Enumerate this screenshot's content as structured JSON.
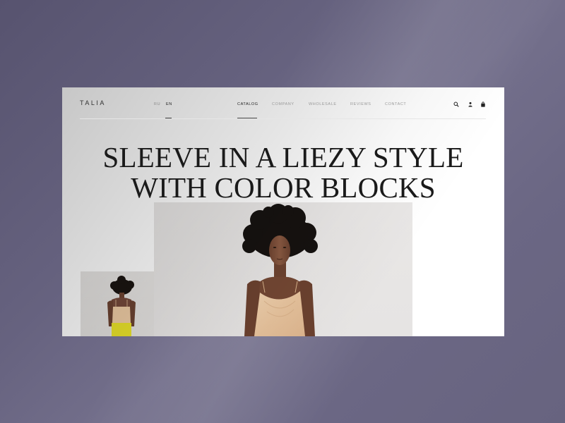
{
  "brand": {
    "logo": "TALIA"
  },
  "header": {
    "languages": [
      {
        "label": "RU",
        "active": false
      },
      {
        "label": "EN",
        "active": true
      }
    ],
    "nav": [
      {
        "label": "CATALOG",
        "active": true
      },
      {
        "label": "COMPANY",
        "active": false
      },
      {
        "label": "WHOLESALE",
        "active": false
      },
      {
        "label": "REVIEWS",
        "active": false
      },
      {
        "label": "CONTACT",
        "active": false
      }
    ],
    "icons": [
      "search-icon",
      "user-icon",
      "bag-icon"
    ]
  },
  "hero": {
    "title_line1": "SLEEVE IN A LIEZY STYLE",
    "title_line2": "WITH COLOR BLOCKS"
  },
  "colors": {
    "backdrop": "#5f5b78",
    "page": "#ffffff",
    "text": "#1a1a1a",
    "dress_peach": "#e9c9a4",
    "skirt_yellow": "#e8e12a"
  }
}
